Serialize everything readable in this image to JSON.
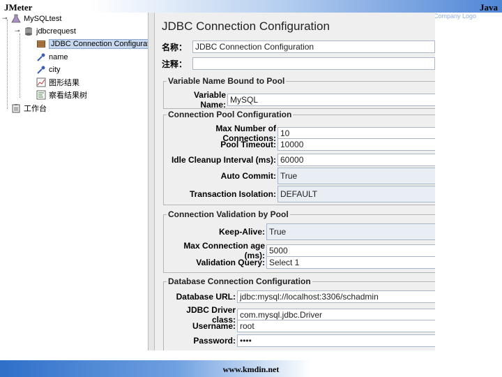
{
  "slide": {
    "header_left": "JMeter",
    "header_right": "Java",
    "company_logo": "Company Logo",
    "footer": "www.kmdin.net"
  },
  "tree": {
    "root": "MySQLtest",
    "group": "jdbcrequest",
    "items": [
      {
        "label": "JDBC Connection Configuratio",
        "icon": "jdbc-config-icon"
      },
      {
        "label": "name",
        "icon": "dropper-icon"
      },
      {
        "label": "city",
        "icon": "dropper-icon"
      },
      {
        "label": "图形结果",
        "icon": "graph-results-icon"
      },
      {
        "label": "察看结果树",
        "icon": "results-tree-icon"
      }
    ],
    "workbench": "工作台"
  },
  "panel": {
    "title": "JDBC Connection Configuration",
    "name_label": "名称：",
    "name_value": "JDBC Connection Configuration",
    "comment_label": "注释：",
    "comment_value": "",
    "pool_variable": {
      "legend": "Variable Name Bound to Pool",
      "variable_label": "Variable Name:",
      "variable_value": "MySQL"
    },
    "pool_config": {
      "legend": "Connection Pool Configuration",
      "max_connections_label": "Max Number of Connections:",
      "max_connections_value": "10",
      "pool_timeout_label": "Pool Timeout:",
      "pool_timeout_value": "10000",
      "idle_cleanup_label": "Idle Cleanup Interval (ms):",
      "idle_cleanup_value": "60000",
      "auto_commit_label": "Auto Commit:",
      "auto_commit_value": "True",
      "transaction_label": "Transaction Isolation:",
      "transaction_value": "DEFAULT"
    },
    "validation": {
      "legend": "Connection Validation by Pool",
      "keep_alive_label": "Keep-Alive:",
      "keep_alive_value": "True",
      "max_age_label": "Max Connection age (ms):",
      "max_age_value": "5000",
      "query_label": "Validation Query:",
      "query_value": "Select 1"
    },
    "database": {
      "legend": "Database Connection Configuration",
      "url_label": "Database URL:",
      "url_value": "jdbc:mysql://localhost:3306/schadmin",
      "driver_label": "JDBC Driver class:",
      "driver_value": "com.mysql.jdbc.Driver",
      "username_label": "Username:",
      "username_value": "root",
      "password_label": "Password:",
      "password_value": "••••"
    }
  }
}
